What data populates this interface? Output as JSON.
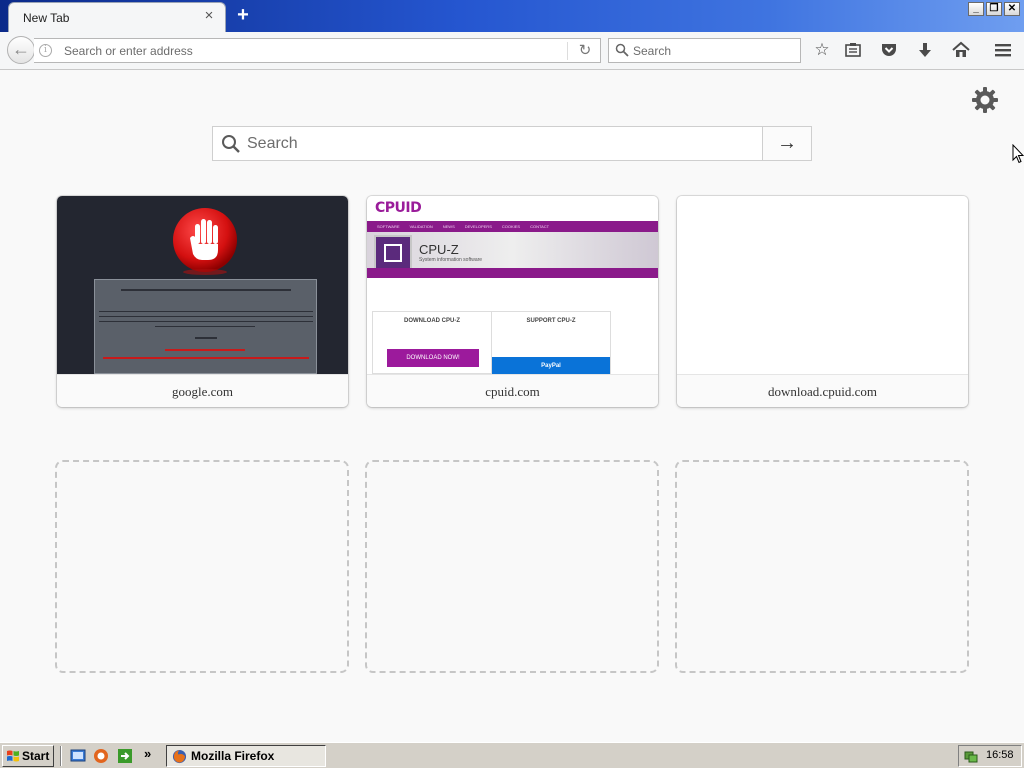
{
  "window": {
    "tab_title": "New Tab",
    "new_tab_label": "+",
    "controls": [
      "minimize",
      "restore",
      "close"
    ]
  },
  "navbar": {
    "url_placeholder": "Search or enter address",
    "search_placeholder": "Search",
    "icons": [
      "back-icon",
      "info-icon",
      "reload-icon",
      "search-icon",
      "bookmark-star-icon",
      "reading-list-icon",
      "pocket-icon",
      "download-icon",
      "home-icon",
      "menu-icon"
    ]
  },
  "newtab": {
    "search_placeholder": "Search",
    "go_label": "→",
    "tiles": [
      {
        "title": "google.com",
        "thumbnail": "blocked-page-stop-hand"
      },
      {
        "title": "cpuid.com",
        "thumbnail": "cpuid-website"
      },
      {
        "title": "download.cpuid.com",
        "thumbnail": "blank"
      }
    ],
    "empty_slots": 3,
    "thumb_text": {
      "cpuid_logo": "CPUID",
      "cpuid_nav": [
        "SOFTWARE",
        "VALIDATION",
        "NEWS",
        "DEVELOPERS",
        "COOKIES",
        "CONTACT"
      ],
      "cpuz_title": "CPU-Z",
      "cpuz_subtitle": "System information software",
      "download_heading": "DOWNLOAD CPU-Z",
      "download_button": "DOWNLOAD NOW!",
      "support_heading": "SUPPORT CPU-Z",
      "paypal": "PayPal"
    }
  },
  "taskbar": {
    "start_label": "Start",
    "task_label": "Mozilla Firefox",
    "more_label": "»",
    "clock": "16:58",
    "colors": {
      "taskbar": "#d4d0c8"
    }
  }
}
